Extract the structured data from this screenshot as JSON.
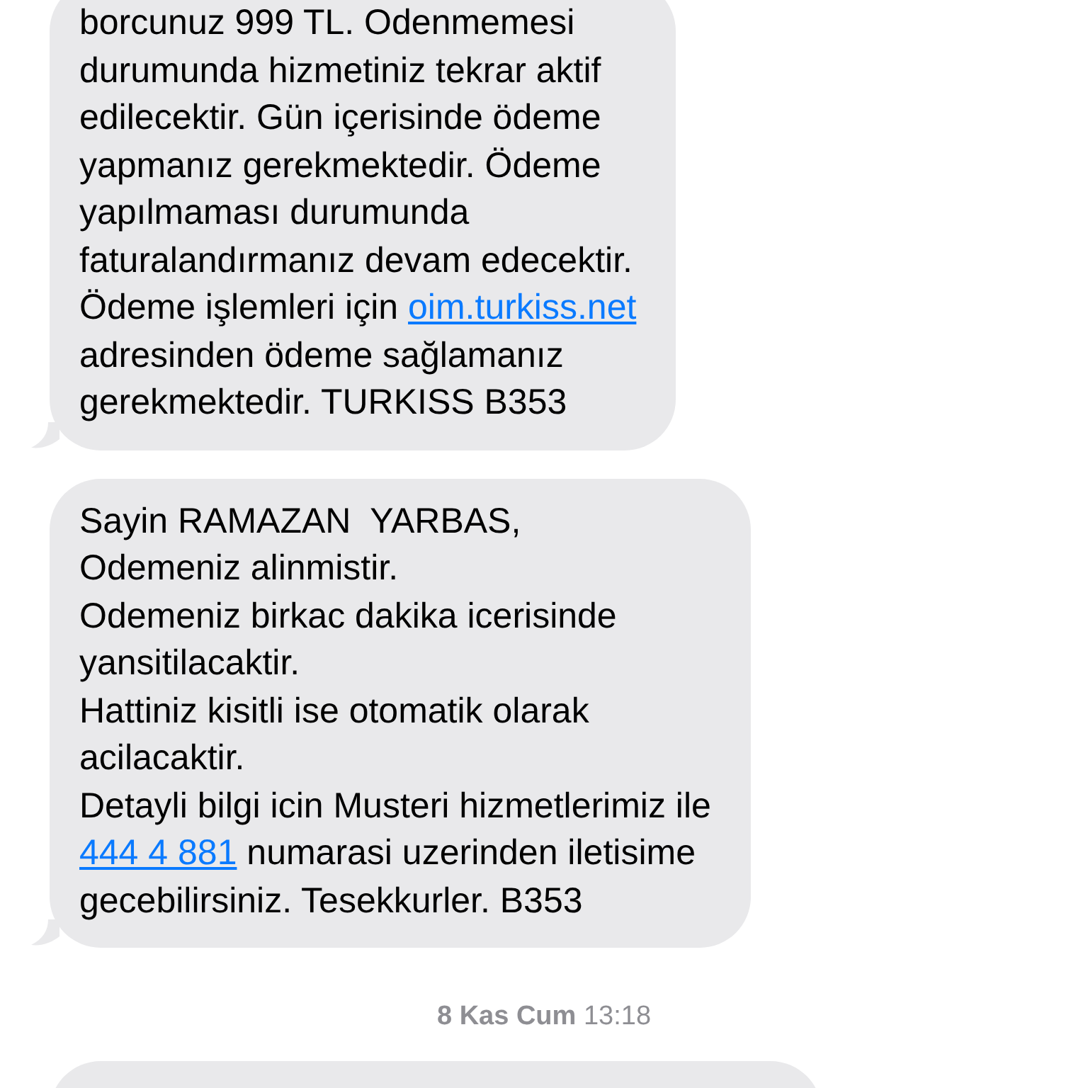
{
  "messages": [
    {
      "parts": [
        {
          "kind": "text",
          "text": "borcunuz 999 TL. Odenmemesi\ndurumunda hizmetiniz tekrar aktif\nedilecektir. Gün içerisinde ödeme\nyapmanız gerekmektedir. Ödeme\nyapılmaması durumunda\nfaturalandırmanız devam edecektir.\nÖdeme işlemleri için "
        },
        {
          "kind": "link",
          "text": "oim.turkiss.net"
        },
        {
          "kind": "text",
          "text": "\nadresinden ödeme sağlamanız\ngerekmektedir. TURKISS B353"
        }
      ]
    },
    {
      "parts": [
        {
          "kind": "text",
          "text": "Sayin RAMAZAN  YARBAS,\nOdemeniz alinmistir.\nOdemeniz birkac dakika icerisinde\nyansitilacaktir.\nHattiniz kisitli ise otomatik olarak\nacilacaktir.\nDetayli bilgi icin Musteri hizmetlerimiz ile\n"
        },
        {
          "kind": "link",
          "text": "444 4 881"
        },
        {
          "kind": "text",
          "text": " numarasi uzerinden iletisime\ngecebilirsiniz. Tesekkurler. B353"
        }
      ]
    }
  ],
  "timestamp": "**8 Kas Cum** 13:18"
}
